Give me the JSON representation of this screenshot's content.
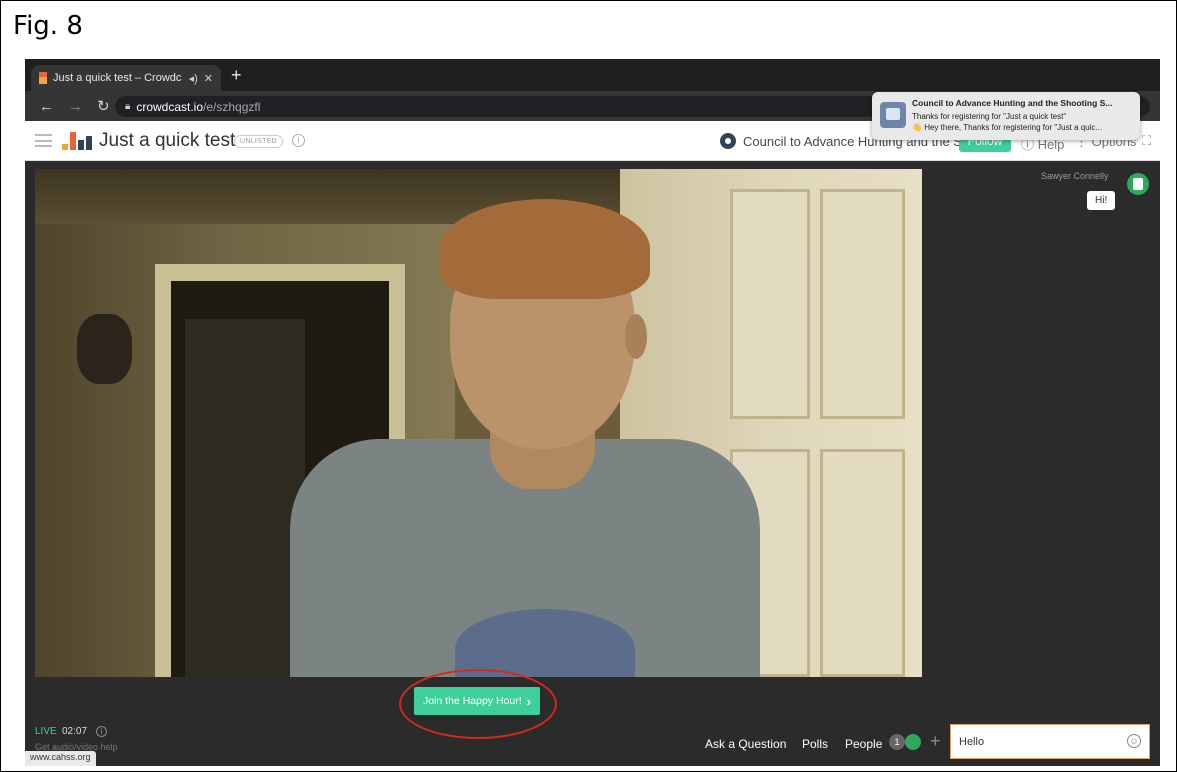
{
  "figure": {
    "label": "Fig. 8"
  },
  "browser": {
    "tab_title": "Just a quick test – Crowdc",
    "tab_audio_icon": "speaker-icon",
    "new_tab": "+",
    "url_host": "crowdcast.io",
    "url_path": "/e/szhqgzfl"
  },
  "notification": {
    "title": "Council to Advance Hunting and the Shooting S...",
    "subtitle": "Thanks for registering for \"Just a quick test\"",
    "body": "Hey there, Thanks for registering for \"Just a quic...",
    "emoji": "👋"
  },
  "header": {
    "title": "Just a quick test",
    "badge": "UNLISTED",
    "host_name": "Council to Advance Hunting and the S...",
    "follow_label": "Follow",
    "help_label": "Help",
    "options_label": "Options"
  },
  "main": {
    "join_button": "Join the Happy Hour!",
    "join_chevron": "›",
    "live_label": "LIVE",
    "live_time": "02:07",
    "av_help": "Get audio/video help",
    "status_url": "www.cahss.org"
  },
  "chat": {
    "sender": "Sawyer Connelly",
    "message": "Hi!",
    "input_value": "Hello"
  },
  "bottom_tabs": {
    "ask": "Ask a Question",
    "polls": "Polls",
    "people": "People",
    "people_count": "1"
  },
  "colors": {
    "accent": "#3ecf9a",
    "highlight_ring": "#d42a1d",
    "dark_bg": "#2b2b2b"
  }
}
